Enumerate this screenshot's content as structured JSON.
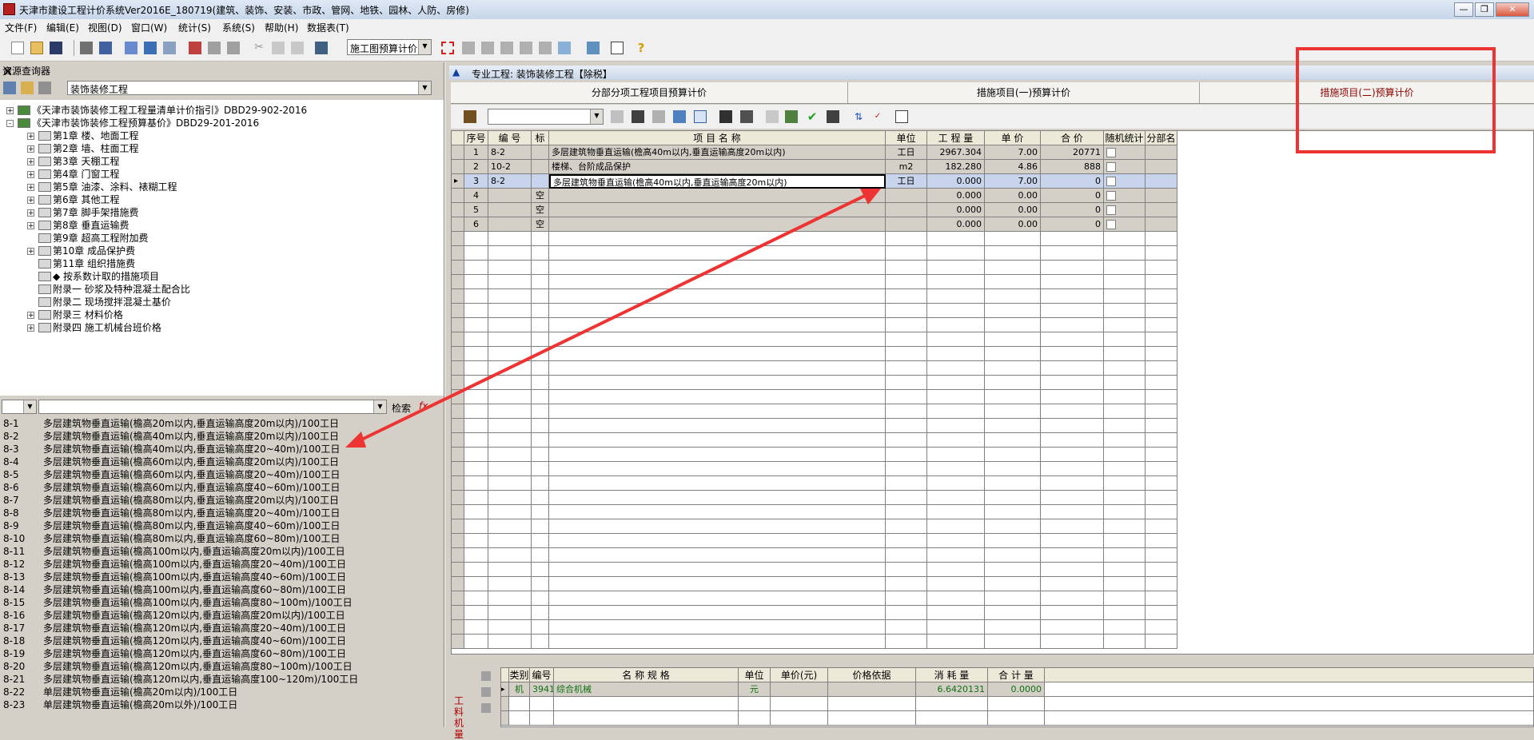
{
  "window": {
    "title": "天津市建设工程计价系统Ver2016E_180719(建筑、装饰、安装、市政、管网、地铁、园林、人防、房修)",
    "minimize": "—",
    "restore": "❐",
    "close": "✕"
  },
  "menu": [
    "文件(F)",
    "编辑(E)",
    "视图(D)",
    "窗口(W)",
    "统计(S)",
    "系统(S)",
    "帮助(H)",
    "数据表(T)"
  ],
  "toolbar": {
    "mode_select": "施工图预算计价"
  },
  "left_panel": {
    "title": "资源查询器",
    "close": "✕",
    "library": "装饰装修工程",
    "tree": [
      {
        "label": "《天津市装饰装修工程工程量清单计价指引》DBD29-902-2016",
        "level": 0,
        "expander": "+"
      },
      {
        "label": "《天津市装饰装修工程预算基价》DBD29-201-2016",
        "level": 0,
        "expander": "-"
      },
      {
        "label": "第1章   楼、地面工程",
        "level": 1,
        "expander": "+"
      },
      {
        "label": "第2章   墙、柱面工程",
        "level": 1,
        "expander": "+"
      },
      {
        "label": "第3章   天棚工程",
        "level": 1,
        "expander": "+"
      },
      {
        "label": "第4章   门窗工程",
        "level": 1,
        "expander": "+"
      },
      {
        "label": "第5章   油漆、涂料、裱糊工程",
        "level": 1,
        "expander": "+"
      },
      {
        "label": "第6章   其他工程",
        "level": 1,
        "expander": "+"
      },
      {
        "label": "第7章   脚手架措施费",
        "level": 1,
        "expander": "+"
      },
      {
        "label": "第8章   垂直运输费",
        "level": 1,
        "expander": "+"
      },
      {
        "label": "第9章   超高工程附加费",
        "level": 1,
        "expander": ""
      },
      {
        "label": "第10章   成品保护费",
        "level": 1,
        "expander": "+"
      },
      {
        "label": "第11章   组织措施费",
        "level": 1,
        "expander": ""
      },
      {
        "label": "◆  按系数计取的措施项目",
        "level": 1,
        "expander": ""
      },
      {
        "label": "附录一   砂浆及特种混凝土配合比",
        "level": 1,
        "expander": ""
      },
      {
        "label": "附录二   现场搅拌混凝土基价",
        "level": 1,
        "expander": ""
      },
      {
        "label": "附录三   材料价格",
        "level": 1,
        "expander": "+"
      },
      {
        "label": "附录四   施工机械台班价格",
        "level": 1,
        "expander": "+"
      }
    ],
    "search_label": "检索",
    "fx": "fx",
    "items": [
      {
        "code": "8-1",
        "name": "多层建筑物垂直运输(檐高20m以内,垂直运输高度20m以内)/100工日"
      },
      {
        "code": "8-2",
        "name": "多层建筑物垂直运输(檐高40m以内,垂直运输高度20m以内)/100工日"
      },
      {
        "code": "8-3",
        "name": "多层建筑物垂直运输(檐高40m以内,垂直运输高度20~40m)/100工日"
      },
      {
        "code": "8-4",
        "name": "多层建筑物垂直运输(檐高60m以内,垂直运输高度20m以内)/100工日"
      },
      {
        "code": "8-5",
        "name": "多层建筑物垂直运输(檐高60m以内,垂直运输高度20~40m)/100工日"
      },
      {
        "code": "8-6",
        "name": "多层建筑物垂直运输(檐高60m以内,垂直运输高度40~60m)/100工日"
      },
      {
        "code": "8-7",
        "name": "多层建筑物垂直运输(檐高80m以内,垂直运输高度20m以内)/100工日"
      },
      {
        "code": "8-8",
        "name": "多层建筑物垂直运输(檐高80m以内,垂直运输高度20~40m)/100工日"
      },
      {
        "code": "8-9",
        "name": "多层建筑物垂直运输(檐高80m以内,垂直运输高度40~60m)/100工日"
      },
      {
        "code": "8-10",
        "name": "多层建筑物垂直运输(檐高80m以内,垂直运输高度60~80m)/100工日"
      },
      {
        "code": "8-11",
        "name": "多层建筑物垂直运输(檐高100m以内,垂直运输高度20m以内)/100工日"
      },
      {
        "code": "8-12",
        "name": "多层建筑物垂直运输(檐高100m以内,垂直运输高度20~40m)/100工日"
      },
      {
        "code": "8-13",
        "name": "多层建筑物垂直运输(檐高100m以内,垂直运输高度40~60m)/100工日"
      },
      {
        "code": "8-14",
        "name": "多层建筑物垂直运输(檐高100m以内,垂直运输高度60~80m)/100工日"
      },
      {
        "code": "8-15",
        "name": "多层建筑物垂直运输(檐高100m以内,垂直运输高度80~100m)/100工日"
      },
      {
        "code": "8-16",
        "name": "多层建筑物垂直运输(檐高120m以内,垂直运输高度20m以内)/100工日"
      },
      {
        "code": "8-17",
        "name": "多层建筑物垂直运输(檐高120m以内,垂直运输高度20~40m)/100工日"
      },
      {
        "code": "8-18",
        "name": "多层建筑物垂直运输(檐高120m以内,垂直运输高度40~60m)/100工日"
      },
      {
        "code": "8-19",
        "name": "多层建筑物垂直运输(檐高120m以内,垂直运输高度60~80m)/100工日"
      },
      {
        "code": "8-20",
        "name": "多层建筑物垂直运输(檐高120m以内,垂直运输高度80~100m)/100工日"
      },
      {
        "code": "8-21",
        "name": "多层建筑物垂直运输(檐高120m以内,垂直运输高度100~120m)/100工日"
      },
      {
        "code": "8-22",
        "name": "单层建筑物垂直运输(檐高20m以内)/100工日"
      },
      {
        "code": "8-23",
        "name": "单层建筑物垂直运输(檐高20m以外)/100工日"
      }
    ]
  },
  "project": {
    "title": "专业工程: 装饰装修工程【除税】"
  },
  "tabs": [
    "分部分项工程项目预算计价",
    "措施项目(一)预算计价",
    "措施项目(二)预算计价"
  ],
  "grid": {
    "headers": [
      "序号",
      "编  号",
      "标",
      "项   目   名   称",
      "单位",
      "工 程 量",
      "单  价",
      "合  价",
      "随机统计",
      "分部名"
    ],
    "rows": [
      {
        "no": "1",
        "code": "8-2",
        "flag": "",
        "name": "多层建筑物垂直运输(檐高40m以内,垂直运输高度20m以内)",
        "unit": "工日",
        "qty": "2967.304",
        "price": "7.00",
        "total": "20771"
      },
      {
        "no": "2",
        "code": "10-2",
        "flag": "",
        "name": "楼梯、台阶成品保护",
        "unit": "m2",
        "qty": "182.280",
        "price": "4.86",
        "total": "888"
      },
      {
        "no": "3",
        "code": "8-2",
        "flag": "",
        "name": "多层建筑物垂直运输(檐高40m以内,垂直运输高度20m以内)",
        "unit": "工日",
        "qty": "0.000",
        "price": "7.00",
        "total": "0"
      },
      {
        "no": "4",
        "code": "",
        "flag": "空",
        "name": "",
        "unit": "",
        "qty": "0.000",
        "price": "0.00",
        "total": "0"
      },
      {
        "no": "5",
        "code": "",
        "flag": "空",
        "name": "",
        "unit": "",
        "qty": "0.000",
        "price": "0.00",
        "total": "0"
      },
      {
        "no": "6",
        "code": "",
        "flag": "空",
        "name": "",
        "unit": "",
        "qty": "0.000",
        "price": "0.00",
        "total": "0"
      }
    ]
  },
  "bottom": {
    "side_tab": "工料机量",
    "headers": [
      "类别",
      "编号",
      "名   称   规   格",
      "单位",
      "单价(元)",
      "价格依据",
      "消 耗 量",
      "合 计 量"
    ],
    "rows": [
      {
        "type": "机",
        "code": "3941",
        "name": "综合机械",
        "unit": "元",
        "price": "",
        "basis": "",
        "consumption": "6.6420131",
        "sum": "0.0000"
      }
    ]
  },
  "colors": {
    "annotation_red": "#ee3333",
    "selected_row": "#c8d4ec",
    "highlight_tab_text": "#8b0000"
  }
}
